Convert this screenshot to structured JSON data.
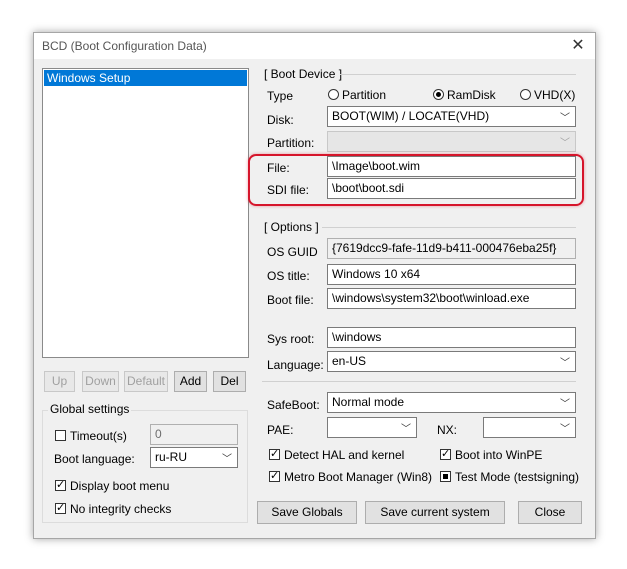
{
  "window": {
    "title": "BCD (Boot Configuration Data)",
    "close_glyph": "✕"
  },
  "entries": {
    "items": [
      "Windows Setup"
    ]
  },
  "entry_buttons": {
    "up": "Up",
    "down": "Down",
    "default": "Default",
    "add": "Add",
    "del": "Del"
  },
  "global": {
    "title": "Global settings",
    "timeout_label": "Timeout(s)",
    "timeout_value": "0",
    "boot_language_label": "Boot language:",
    "boot_language_value": "ru-RU",
    "display_boot_menu": "Display boot menu",
    "no_integrity_checks": "No integrity checks"
  },
  "boot_device": {
    "title": "[ Boot Device ]",
    "type_label": "Type",
    "type_options": {
      "partition": "Partition",
      "ramdisk": "RamDisk",
      "vhd": "VHD(X)"
    },
    "selected_type": "ramdisk",
    "disk_label": "Disk:",
    "disk_value": "BOOT(WIM) / LOCATE(VHD)",
    "partition_label": "Partition:",
    "partition_value": "",
    "file_label": "File:",
    "file_value": "\\Image\\boot.wim",
    "sdi_label": "SDI file:",
    "sdi_value": "\\boot\\boot.sdi"
  },
  "options": {
    "title": "[ Options ]",
    "guid_label": "OS GUID",
    "guid_value": "{7619dcc9-fafe-11d9-b411-000476eba25f}",
    "os_title_label": "OS title:",
    "os_title_value": "Windows 10 x64",
    "boot_file_label": "Boot file:",
    "boot_file_value": "\\windows\\system32\\boot\\winload.exe",
    "sys_root_label": "Sys root:",
    "sys_root_value": "\\windows",
    "language_label": "Language:",
    "language_value": "en-US",
    "safeboot_label": "SafeBoot:",
    "safeboot_value": "Normal mode",
    "pae_label": "PAE:",
    "pae_value": "",
    "nx_label": "NX:",
    "nx_value": "",
    "detect_hal": "Detect HAL and kernel",
    "boot_winpe": "Boot into WinPE",
    "metro_boot": "Metro Boot Manager (Win8)",
    "test_mode": "Test Mode (testsigning)"
  },
  "bottom_buttons": {
    "save_globals": "Save Globals",
    "save_current": "Save current system",
    "close": "Close"
  },
  "colors": {
    "accent": "#0078d7",
    "highlight": "#d6152b"
  }
}
